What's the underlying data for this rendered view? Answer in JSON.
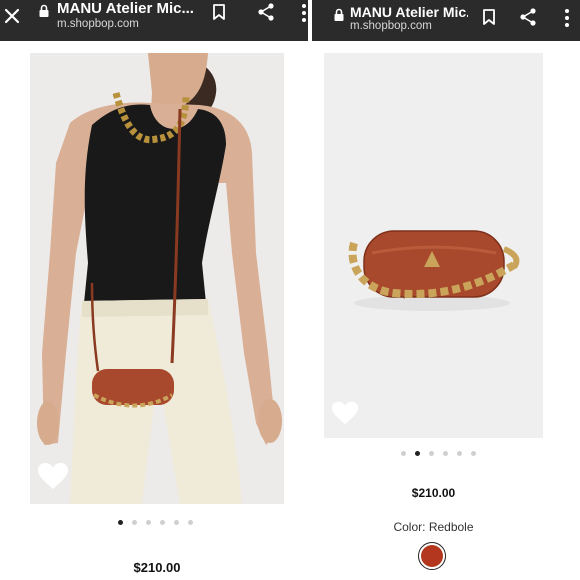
{
  "left": {
    "header": {
      "title": "MANU Atelier Mic...",
      "url": "m.shopbop.com",
      "icons": [
        "close-icon",
        "lock-icon",
        "bookmark-icon",
        "share-icon",
        "more-icon"
      ]
    },
    "carousel": {
      "slides": 6,
      "active": 1
    },
    "price": "$210.00"
  },
  "right": {
    "header": {
      "title": "MANU Atelier Mic...",
      "url": "m.shopbop.com",
      "icons": [
        "lock-icon",
        "bookmark-icon",
        "share-icon",
        "more-icon"
      ]
    },
    "carousel": {
      "slides": 6,
      "active": 2
    },
    "price": "$210.00",
    "color_label": "Color: Redbole",
    "swatch_color": "#b3361f"
  },
  "colors": {
    "bar": "#2b2b2b",
    "bag": "#a8482c",
    "gold": "#c9a45a"
  }
}
